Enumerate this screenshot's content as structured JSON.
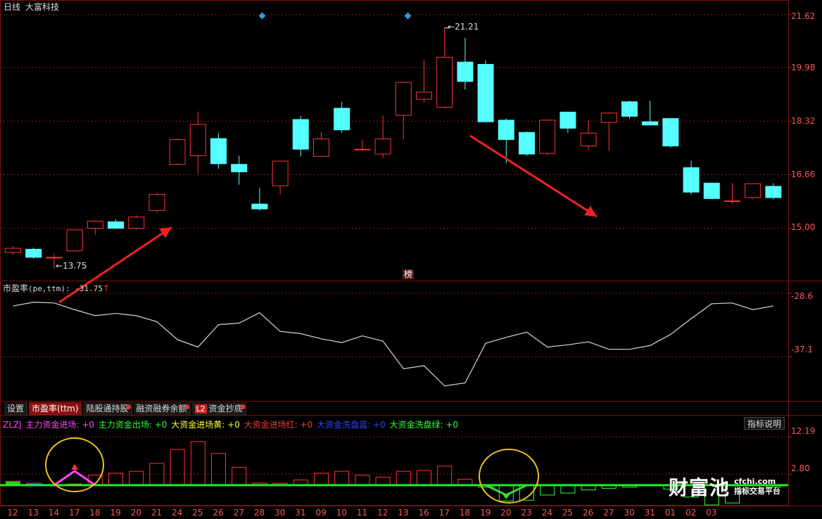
{
  "header": {
    "period": "日线",
    "stock_name": "大富科技"
  },
  "price_axis": {
    "labels": [
      "21.62",
      "19.98",
      "18.32",
      "16.66",
      "15.00"
    ]
  },
  "pe_axis": {
    "labels": [
      "-28.6",
      "-37.1"
    ]
  },
  "volume_axis": {
    "labels": [
      "12.19",
      "2.80"
    ]
  },
  "annotations": {
    "high_label": "21.21",
    "low_label": "13.75",
    "rank_badge": "榜"
  },
  "pe_panel": {
    "title": "市盈率",
    "params": "(pe,ttm): -31.75",
    "up_arrow": "↑"
  },
  "tabs": [
    {
      "label": "设置",
      "active": false,
      "badge": "",
      "dot": false
    },
    {
      "label": "市盈率(ttm)",
      "active": true,
      "badge": "",
      "dot": false
    },
    {
      "label": "陆股通持股",
      "active": false,
      "badge": "",
      "dot": true
    },
    {
      "label": "融资融券余额",
      "active": false,
      "badge": "",
      "dot": true
    },
    {
      "label": "资金抄底",
      "active": false,
      "badge": "L2",
      "dot": true
    }
  ],
  "legend": {
    "name": "ZLZJ",
    "items": [
      {
        "text": "主力资金进场: +0",
        "color": "#ff44ff"
      },
      {
        "text": "主力资金出场: +0",
        "color": "#33ff33"
      },
      {
        "text": "大资金进场黄: +0",
        "color": "#ffff33"
      },
      {
        "text": "大资金进场红: +0",
        "color": "#ff3333"
      },
      {
        "text": "大资金洗盘蓝: +0",
        "color": "#3344ff"
      },
      {
        "text": "大资金洗盘绿: +0",
        "color": "#33ff33"
      }
    ]
  },
  "help_button": "指标说明",
  "date_axis": [
    "12",
    "13",
    "14",
    "17",
    "18",
    "19",
    "20",
    "21",
    "24",
    "25",
    "26",
    "27",
    "28",
    "30",
    "31",
    "09",
    "10",
    "11",
    "12",
    "13",
    "16",
    "17",
    "18",
    "19",
    "20",
    "23",
    "24",
    "25",
    "26",
    "27",
    "30",
    "31",
    "01",
    "02",
    "03"
  ],
  "watermark": {
    "brand": "财富池",
    "domain": "cfchi.com",
    "slogan": "指标交易平台"
  },
  "colors": {
    "up": "#ff3333",
    "down": "#55ffff",
    "grid": "#8a1a1a",
    "pe_line": "#d8d8d8",
    "baseline": "#22ee22"
  },
  "chart_data": [
    {
      "type": "candlestick",
      "ylim": [
        13.4,
        21.9
      ],
      "yticks": [
        21.62,
        19.98,
        18.32,
        16.66,
        15.0
      ],
      "candles": [
        {
          "o": 14.25,
          "c": 14.38,
          "h": 14.45,
          "l": 14.18
        },
        {
          "o": 14.35,
          "c": 14.1,
          "h": 14.4,
          "l": 14.05
        },
        {
          "o": 14.1,
          "c": 14.1,
          "h": 14.2,
          "l": 13.75
        },
        {
          "o": 14.3,
          "c": 14.95,
          "h": 14.95,
          "l": 14.28
        },
        {
          "o": 15.0,
          "c": 15.22,
          "h": 15.25,
          "l": 14.8
        },
        {
          "o": 15.2,
          "c": 15.0,
          "h": 15.28,
          "l": 14.98
        },
        {
          "o": 15.0,
          "c": 15.35,
          "h": 15.4,
          "l": 14.95
        },
        {
          "o": 15.55,
          "c": 16.05,
          "h": 16.1,
          "l": 15.5
        },
        {
          "o": 16.98,
          "c": 17.75,
          "h": 17.78,
          "l": 16.95
        },
        {
          "o": 17.25,
          "c": 18.22,
          "h": 18.62,
          "l": 16.7
        },
        {
          "o": 17.78,
          "c": 17.0,
          "h": 17.95,
          "l": 16.85
        },
        {
          "o": 16.98,
          "c": 16.75,
          "h": 17.25,
          "l": 16.35
        },
        {
          "o": 15.75,
          "c": 15.6,
          "h": 16.25,
          "l": 15.55
        },
        {
          "o": 16.32,
          "c": 17.08,
          "h": 17.08,
          "l": 16.05
        },
        {
          "o": 18.37,
          "c": 17.45,
          "h": 18.48,
          "l": 17.23
        },
        {
          "o": 17.23,
          "c": 17.77,
          "h": 18.0,
          "l": 17.23
        },
        {
          "o": 18.72,
          "c": 18.05,
          "h": 18.92,
          "l": 17.95
        },
        {
          "o": 17.45,
          "c": 17.45,
          "h": 17.75,
          "l": 17.4
        },
        {
          "o": 17.3,
          "c": 17.77,
          "h": 18.5,
          "l": 17.18
        },
        {
          "o": 18.5,
          "c": 19.52,
          "h": 19.52,
          "l": 17.75
        },
        {
          "o": 19.0,
          "c": 19.22,
          "h": 20.22,
          "l": 18.9
        },
        {
          "o": 18.75,
          "c": 20.3,
          "h": 21.21,
          "l": 18.7
        },
        {
          "o": 20.15,
          "c": 19.55,
          "h": 20.9,
          "l": 19.3
        },
        {
          "o": 20.08,
          "c": 18.3,
          "h": 20.2,
          "l": 18.3
        },
        {
          "o": 18.35,
          "c": 17.75,
          "h": 18.4,
          "l": 17.02
        },
        {
          "o": 17.97,
          "c": 17.3,
          "h": 18.0,
          "l": 17.25
        },
        {
          "o": 17.32,
          "c": 18.35,
          "h": 18.38,
          "l": 17.26
        },
        {
          "o": 18.6,
          "c": 18.1,
          "h": 18.62,
          "l": 17.95
        },
        {
          "o": 17.55,
          "c": 17.95,
          "h": 18.35,
          "l": 17.4
        },
        {
          "o": 18.28,
          "c": 18.57,
          "h": 18.6,
          "l": 17.4
        },
        {
          "o": 18.92,
          "c": 18.47,
          "h": 18.95,
          "l": 18.4
        },
        {
          "o": 18.3,
          "c": 18.2,
          "h": 18.95,
          "l": 18.2
        },
        {
          "o": 18.4,
          "c": 17.55,
          "h": 18.42,
          "l": 17.5
        },
        {
          "o": 16.88,
          "c": 16.12,
          "h": 17.1,
          "l": 16.05
        },
        {
          "o": 16.4,
          "c": 15.92,
          "h": 16.42,
          "l": 15.9
        },
        {
          "o": 15.85,
          "c": 15.85,
          "h": 16.4,
          "l": 15.75
        },
        {
          "o": 15.95,
          "c": 16.38,
          "h": 16.4,
          "l": 15.9
        },
        {
          "o": 16.3,
          "c": 15.95,
          "h": 16.4,
          "l": 15.9
        }
      ]
    },
    {
      "type": "line",
      "name": "市盈率",
      "ylim": [
        -43.0,
        -27.0
      ],
      "yticks": [
        -28.6,
        -37.1
      ],
      "values": [
        -30.3,
        -29.8,
        -29.9,
        -30.8,
        -31.6,
        -31.3,
        -31.6,
        -32.4,
        -34.8,
        -35.8,
        -32.8,
        -32.6,
        -31.2,
        -33.7,
        -34.0,
        -34.7,
        -35.2,
        -34.3,
        -35.0,
        -38.7,
        -38.3,
        -41.0,
        -40.6,
        -35.3,
        -34.5,
        -33.8,
        -35.8,
        -35.5,
        -35.1,
        -36.1,
        -36.1,
        -35.6,
        -34.1,
        -32.0,
        -30.0,
        -29.9,
        -30.8,
        -30.3
      ]
    },
    {
      "type": "bar",
      "name": "ZLZJ",
      "ylim": [
        -5.0,
        14.0
      ],
      "yticks": [
        12.19,
        2.8
      ],
      "values": [
        1.0,
        0.5,
        0.0,
        0.3,
        2.5,
        3.0,
        3.5,
        5.5,
        9.0,
        11.0,
        8.0,
        4.5,
        0.5,
        0.5,
        1.3,
        3.0,
        3.5,
        2.5,
        2.0,
        3.5,
        3.7,
        4.8,
        1.5,
        -0.5,
        -4.0,
        -3.8,
        -2.5,
        -2.0,
        -1.2,
        -0.8,
        -0.5,
        -0.2,
        -1.0,
        -3.0,
        -5.0,
        -4.5,
        -0.8,
        -0.5
      ]
    }
  ]
}
